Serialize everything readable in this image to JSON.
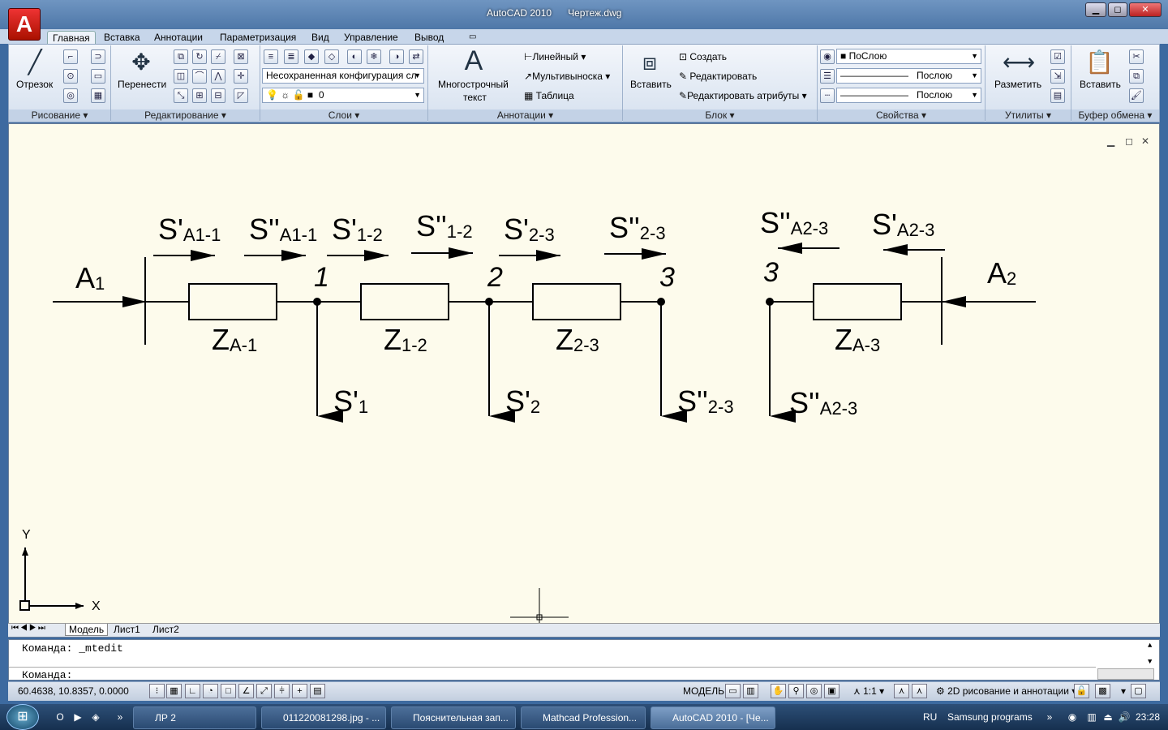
{
  "window": {
    "app_title": "AutoCAD 2010",
    "doc_title": "Чертеж.dwg",
    "minimize": "▁",
    "restore": "◻",
    "close": "✕"
  },
  "ribbon": {
    "tabs": [
      "Главная",
      "Вставка",
      "Аннотации",
      "Параметризация",
      "Вид",
      "Управление",
      "Вывод"
    ],
    "panels": {
      "draw": {
        "label": "Рисование",
        "line": "Отрезок"
      },
      "modify": {
        "label": "Редактирование",
        "move": "Перенести"
      },
      "layers": {
        "label": "Слои",
        "state": "Несохраненная конфигурация сл",
        "current": "0"
      },
      "annotation": {
        "label": "Аннотации",
        "mtext_1": "Многострочный",
        "mtext_2": "текст",
        "linear": "Линейный",
        "multileader": "Мультивыноска",
        "table": "Таблица"
      },
      "block": {
        "label": "Блок",
        "insert": "Вставить",
        "create": "Создать",
        "edit": "Редактировать",
        "edit_attr": "Редактировать атрибуты"
      },
      "properties": {
        "label": "Свойства",
        "color": "ПоСлою",
        "lineweight": "Послою",
        "linetype": "Послою"
      },
      "utilities": {
        "label": "Утилиты",
        "measure": "Разметить"
      },
      "clipboard": {
        "label": "Буфер обмена",
        "paste": "Вставить"
      }
    }
  },
  "drawing": {
    "left": {
      "source": "A",
      "source_sub": "1",
      "flows": [
        {
          "main": "S'",
          "sub": "A1-1"
        },
        {
          "main": "S''",
          "sub": "A1-1"
        },
        {
          "main": "S'",
          "sub": "1-2"
        },
        {
          "main": "S''",
          "sub": "1-2"
        },
        {
          "main": "S'",
          "sub": "2-3"
        },
        {
          "main": "S''",
          "sub": "2-3"
        }
      ],
      "impedances": [
        {
          "main": "Z",
          "sub": "A-1"
        },
        {
          "main": "Z",
          "sub": "1-2"
        },
        {
          "main": "Z",
          "sub": "2-3"
        }
      ],
      "nodes": [
        "1",
        "2",
        "3"
      ],
      "loads": [
        {
          "main": "S'",
          "sub": "1"
        },
        {
          "main": "S'",
          "sub": "2"
        },
        {
          "main": "S''",
          "sub": "2-3"
        }
      ]
    },
    "right": {
      "source": "A",
      "source_sub": "2",
      "flows": [
        {
          "main": "S''",
          "sub": "A2-3"
        },
        {
          "main": "S'",
          "sub": "A2-3"
        }
      ],
      "impedance": {
        "main": "Z",
        "sub": "A-3"
      },
      "node": "3",
      "load": {
        "main": "S''",
        "sub": "A2-3"
      }
    },
    "ucs": {
      "x": "X",
      "y": "Y"
    }
  },
  "layout_tabs": [
    "Модель",
    "Лист1",
    "Лист2"
  ],
  "command": {
    "history": "Команда:  _mtedit",
    "prompt": "Команда:"
  },
  "status": {
    "coords": "60.4638, 10.8357, 0.0000",
    "model": "МОДЕЛЬ",
    "scale": "1:1",
    "workspace": "2D рисование и аннотации"
  },
  "taskbar": {
    "items": [
      "ЛР 2",
      "011220081298.jpg - ...",
      "Пояснительная зап...",
      "Mathcad Profession...",
      "AutoCAD 2010 - [Че..."
    ],
    "lang": "RU",
    "tray_label": "Samsung programs",
    "clock": "23:28"
  }
}
